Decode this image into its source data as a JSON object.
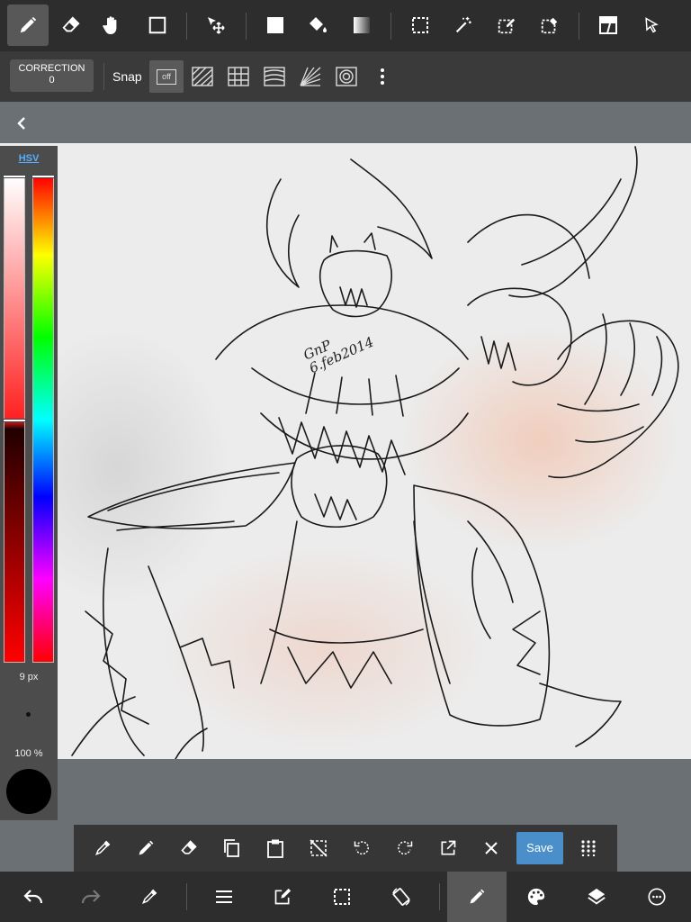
{
  "toolbar_top": {
    "tools": [
      {
        "icon": "pen-icon",
        "active": true
      },
      {
        "icon": "eraser-icon"
      },
      {
        "icon": "hand-icon"
      },
      {
        "icon": "rectangle-icon"
      },
      {
        "icon": "move-transform-icon"
      },
      {
        "icon": "fill-square-icon"
      },
      {
        "icon": "bucket-fill-icon"
      },
      {
        "icon": "gradient-icon"
      },
      {
        "icon": "select-rect-icon"
      },
      {
        "icon": "magic-wand-icon"
      },
      {
        "icon": "select-pen-icon"
      },
      {
        "icon": "select-eraser-icon"
      },
      {
        "icon": "frame-divider-icon"
      },
      {
        "icon": "pointer-icon"
      }
    ]
  },
  "toolbar_second": {
    "correction_label": "CORRECTION",
    "correction_value": "0",
    "snap_label": "Snap",
    "snap_off_label": "off",
    "snap_modes": [
      "parallel-snap-icon",
      "grid-snap-icon",
      "curve-snap-icon",
      "radial-snap-icon",
      "circle-snap-icon"
    ],
    "more_icon": "more-vertical-icon"
  },
  "color_panel": {
    "tab_label": "HSV",
    "value_level": 0.5,
    "brush_size": "9 px",
    "opacity": "100 %",
    "current_color": "#000000"
  },
  "canvas": {
    "signature_line1": "GnP",
    "signature_line2": "6.feb2014"
  },
  "action_bar": {
    "icons": [
      "eyedropper-icon",
      "pen-icon",
      "eraser-icon",
      "copy-icon",
      "paste-icon",
      "deselect-icon",
      "rotate-left-icon",
      "rotate-right-icon",
      "transform-icon",
      "close-icon"
    ],
    "save_label": "Save",
    "grid_icon": "grid-dots-icon"
  },
  "bottom_bar": {
    "icons": [
      "undo-icon",
      "redo-icon",
      "eyedropper-icon",
      "menu-icon",
      "edit-icon",
      "selection-icon",
      "rotate-canvas-icon",
      "brush-icon",
      "palette-icon",
      "layers-icon",
      "settings-icon"
    ]
  },
  "colors": {
    "toolbar_bg": "#2d2d2d",
    "accent_blue": "#4a8fc9",
    "hsv_tab": "#56b0ff"
  }
}
